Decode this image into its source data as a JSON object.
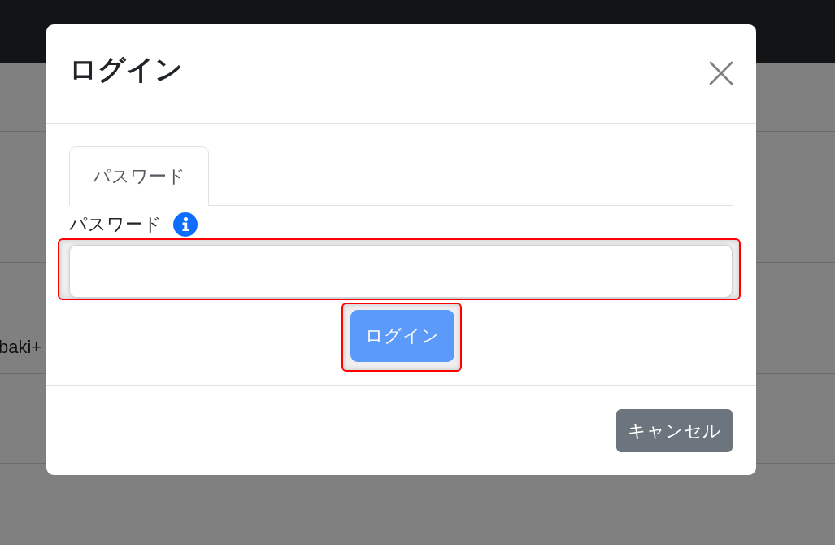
{
  "background_page": {
    "row_text": "baki+"
  },
  "dialog": {
    "title": "ログイン",
    "tabs": [
      {
        "label": "パスワード",
        "selected": true
      }
    ],
    "password_field": {
      "label": "パスワード",
      "highlighted": true
    },
    "login_button": {
      "label": "ログイン",
      "disabled": true,
      "highlighted": true
    },
    "cancel_button": {
      "label": "キャンセル"
    }
  }
}
